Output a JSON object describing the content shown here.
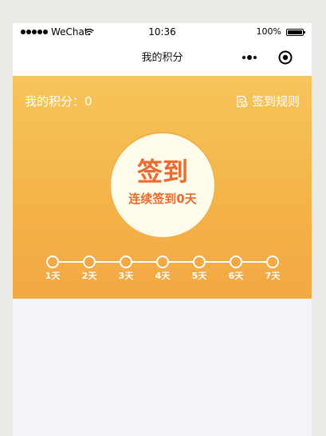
{
  "status_bar": {
    "carrier": "WeChat",
    "time": "10:36",
    "battery": "100%"
  },
  "nav": {
    "title": "我的积分"
  },
  "header": {
    "points_label": "我的积分：0",
    "rules_label": "签到规则"
  },
  "checkin": {
    "title": "签到",
    "subtitle": "连续签到0天"
  },
  "days": [
    "1天",
    "2天",
    "3天",
    "4天",
    "5天",
    "6天",
    "7天"
  ],
  "colors": {
    "accent": "#ea6a2f",
    "header_top": "#f6c55b",
    "header_bottom": "#f3a844",
    "circle_bg": "#fffcec",
    "page_bg": "#f4f3f8"
  }
}
